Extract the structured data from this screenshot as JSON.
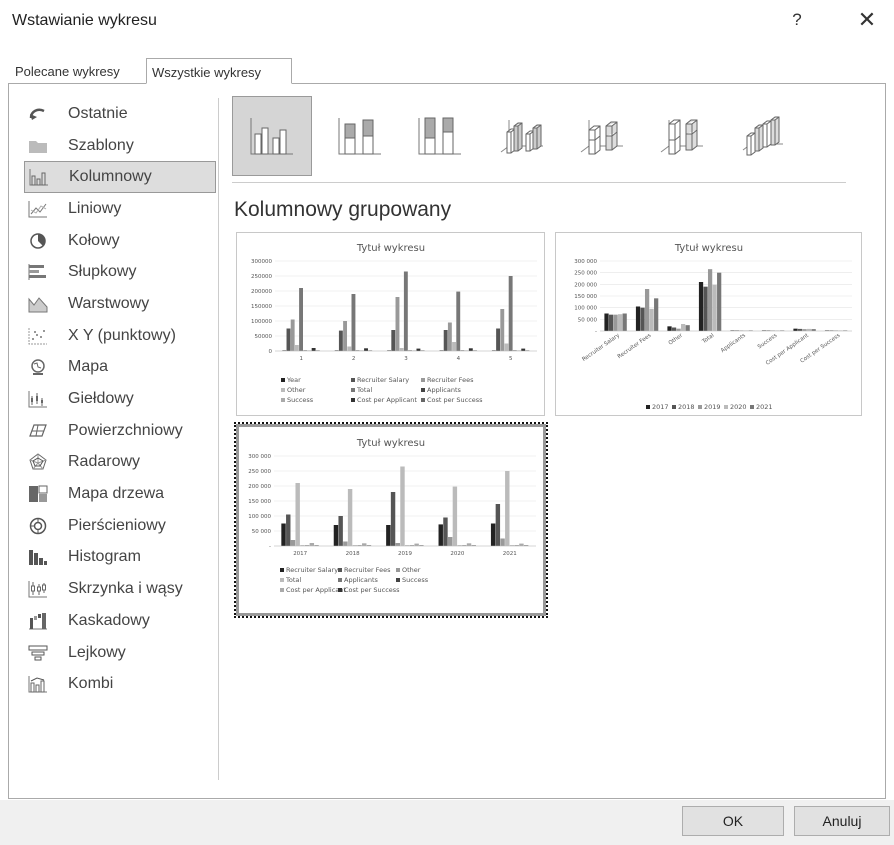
{
  "window": {
    "title": "Wstawianie wykresu",
    "help_label": "?",
    "close_label": "✕"
  },
  "tabs": [
    {
      "label": "Polecane wykresy",
      "active": false
    },
    {
      "label": "Wszystkie wykresy",
      "active": true
    }
  ],
  "sidebar": {
    "items": [
      {
        "label": "Ostatnie",
        "icon": "recent-icon"
      },
      {
        "label": "Szablony",
        "icon": "folder-icon"
      },
      {
        "label": "Kolumnowy",
        "icon": "column-chart-icon",
        "active": true
      },
      {
        "label": "Liniowy",
        "icon": "line-chart-icon"
      },
      {
        "label": "Kołowy",
        "icon": "pie-chart-icon"
      },
      {
        "label": "Słupkowy",
        "icon": "bar-chart-icon"
      },
      {
        "label": "Warstwowy",
        "icon": "area-chart-icon"
      },
      {
        "label": "X Y (punktowy)",
        "icon": "scatter-chart-icon"
      },
      {
        "label": "Mapa",
        "icon": "map-chart-icon"
      },
      {
        "label": "Giełdowy",
        "icon": "stock-chart-icon"
      },
      {
        "label": "Powierzchniowy",
        "icon": "surface-chart-icon"
      },
      {
        "label": "Radarowy",
        "icon": "radar-chart-icon"
      },
      {
        "label": "Mapa drzewa",
        "icon": "treemap-chart-icon"
      },
      {
        "label": "Pierścieniowy",
        "icon": "sunburst-chart-icon"
      },
      {
        "label": "Histogram",
        "icon": "histogram-chart-icon"
      },
      {
        "label": "Skrzynka i wąsy",
        "icon": "box-whisker-chart-icon"
      },
      {
        "label": "Kaskadowy",
        "icon": "waterfall-chart-icon"
      },
      {
        "label": "Lejkowy",
        "icon": "funnel-chart-icon"
      },
      {
        "label": "Kombi",
        "icon": "combo-chart-icon"
      }
    ]
  },
  "subtypes": {
    "selected_index": 0,
    "items": [
      "clustered-column-icon",
      "stacked-column-icon",
      "stacked-100-column-icon",
      "3d-clustered-column-icon",
      "3d-stacked-column-icon",
      "3d-stacked-100-column-icon",
      "3d-column-icon"
    ],
    "selected_name": "Kolumnowy grupowany"
  },
  "chart_data": [
    {
      "type": "bar",
      "title": "Tytuł wykresu",
      "categories": [
        "1",
        "2",
        "3",
        "4",
        "5"
      ],
      "ylim": [
        0,
        300000
      ],
      "yticks": [
        "300000",
        "250000",
        "200000",
        "150000",
        "100000",
        "50000",
        "0"
      ],
      "series": [
        {
          "name": "Year",
          "values": [
            2017,
            2018,
            2019,
            2020,
            2021
          ]
        },
        {
          "name": "Recruiter Salary",
          "values": [
            75000,
            68000,
            70000,
            70000,
            75000
          ]
        },
        {
          "name": "Recruiter Fees",
          "values": [
            105000,
            100000,
            180000,
            95000,
            140000
          ]
        },
        {
          "name": "Other",
          "values": [
            20000,
            15000,
            10000,
            30000,
            25000
          ]
        },
        {
          "name": "Total",
          "values": [
            210000,
            190000,
            265000,
            198000,
            250000
          ]
        },
        {
          "name": "Applicants",
          "values": [
            500,
            500,
            500,
            500,
            500
          ]
        },
        {
          "name": "Success",
          "values": [
            50,
            50,
            50,
            50,
            50
          ]
        },
        {
          "name": "Cost per Applicant",
          "values": [
            10000,
            9000,
            8000,
            9000,
            8000
          ]
        },
        {
          "name": "Cost per Success",
          "values": [
            500,
            500,
            500,
            500,
            500
          ]
        }
      ],
      "legend": "bottom"
    },
    {
      "type": "bar",
      "title": "Tytuł wykresu",
      "categories": [
        "Recruiter Salary",
        "Recruiter Fees",
        "Other",
        "Total",
        "Applicants",
        "Success",
        "Cost per Applicant",
        "Cost per Success"
      ],
      "ylim": [
        0,
        300000
      ],
      "yticks": [
        "300 000",
        "250 000",
        "200 000",
        "150 000",
        "100 000",
        "50 000",
        "-"
      ],
      "series": [
        {
          "name": "2017",
          "values": [
            75000,
            105000,
            20000,
            210000,
            500,
            50,
            10000,
            500
          ]
        },
        {
          "name": "2018",
          "values": [
            70000,
            100000,
            15000,
            190000,
            500,
            50,
            9000,
            500
          ]
        },
        {
          "name": "2019",
          "values": [
            70000,
            180000,
            10000,
            265000,
            500,
            50,
            8000,
            500
          ]
        },
        {
          "name": "2020",
          "values": [
            72000,
            95000,
            30000,
            198000,
            500,
            50,
            9000,
            500
          ]
        },
        {
          "name": "2021",
          "values": [
            75000,
            140000,
            25000,
            250000,
            500,
            50,
            8000,
            500
          ]
        }
      ],
      "legend": "bottom"
    },
    {
      "type": "bar",
      "title": "Tytuł wykresu",
      "categories": [
        "2017",
        "2018",
        "2019",
        "2020",
        "2021"
      ],
      "ylim": [
        0,
        300000
      ],
      "yticks": [
        "300 000",
        "250 000",
        "200 000",
        "150 000",
        "100 000",
        "50 000",
        "-"
      ],
      "series": [
        {
          "name": "Recruiter Salary",
          "values": [
            75000,
            70000,
            70000,
            72000,
            75000
          ]
        },
        {
          "name": "Recruiter Fees",
          "values": [
            105000,
            100000,
            180000,
            95000,
            140000
          ]
        },
        {
          "name": "Other",
          "values": [
            20000,
            15000,
            10000,
            30000,
            25000
          ]
        },
        {
          "name": "Total",
          "values": [
            210000,
            190000,
            265000,
            198000,
            250000
          ]
        },
        {
          "name": "Applicants",
          "values": [
            500,
            500,
            500,
            500,
            500
          ]
        },
        {
          "name": "Success",
          "values": [
            50,
            50,
            50,
            50,
            50
          ]
        },
        {
          "name": "Cost per Applicant",
          "values": [
            10000,
            9000,
            8000,
            9000,
            8000
          ]
        },
        {
          "name": "Cost per Success",
          "values": [
            500,
            500,
            500,
            500,
            500
          ]
        }
      ],
      "legend": "bottom"
    }
  ],
  "footer": {
    "ok_label": "OK",
    "cancel_label": "Anuluj"
  }
}
